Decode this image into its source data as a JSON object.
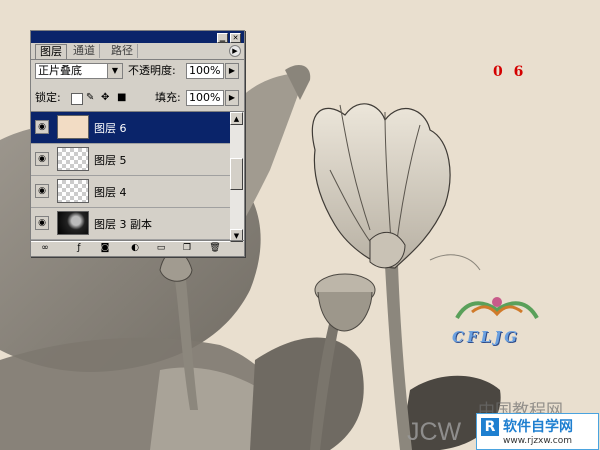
{
  "palette": {
    "tabs": [
      "图层",
      "通道",
      "路径"
    ],
    "blend_mode": "正片叠底",
    "opacity_label": "不透明度:",
    "opacity_value": "100%",
    "lock_label": "锁定:",
    "fill_label": "填充:",
    "fill_value": "100%",
    "layers": [
      {
        "name": "图层 6",
        "thumb": "solid",
        "selected": true
      },
      {
        "name": "图层 5",
        "thumb": "checker",
        "selected": false
      },
      {
        "name": "图层 4",
        "thumb": "checker",
        "selected": false
      },
      {
        "name": "图层 3 副本",
        "thumb": "photo",
        "selected": false
      }
    ]
  },
  "canvas": {
    "step_number": "0 6",
    "logo_text": "CFLJG",
    "watermark_cn": "中国教程网",
    "watermark_en": "JCW",
    "site_title": "软件自学网",
    "site_url": "www.rjzxw.com"
  },
  "colors": {
    "selected_layer": "#0a246a",
    "step_number": "#d40000",
    "canvas_bg": "#e9dfcf"
  }
}
